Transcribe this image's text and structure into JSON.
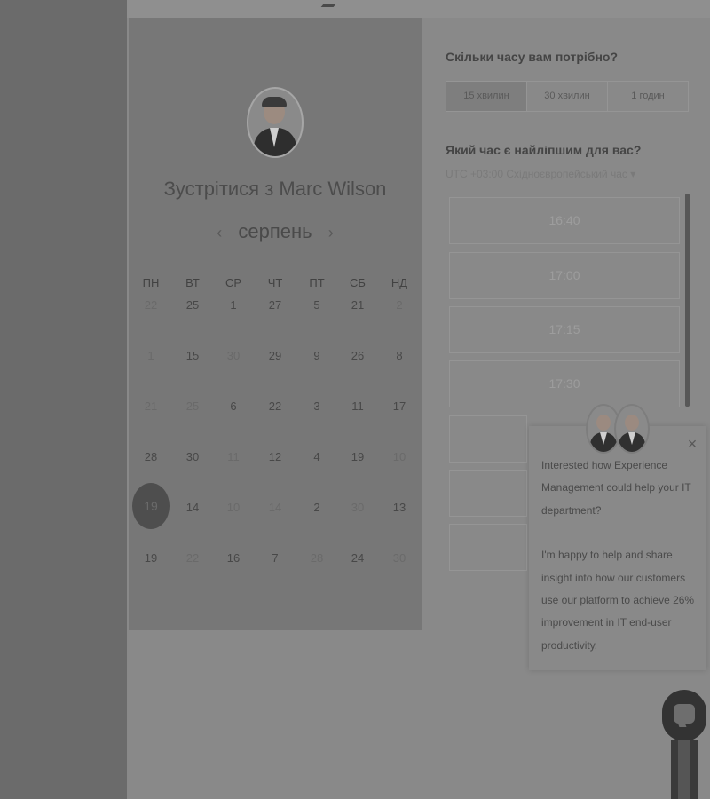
{
  "booking": {
    "meet_title": "Зустрітися з Marc Wilson",
    "month_label": "серпень",
    "prev_month_icon": "‹",
    "next_month_icon": "›",
    "weekdays": [
      "ПН",
      "ВТ",
      "СР",
      "ЧТ",
      "ПТ",
      "СБ",
      "НД"
    ],
    "calendar_rows": [
      [
        "22",
        "25",
        "1",
        "27",
        "5",
        "21",
        "2"
      ],
      [
        "1",
        "15",
        "30",
        "29",
        "9",
        "26",
        "8"
      ],
      [
        "21",
        "25",
        "6",
        "22",
        "3",
        "11",
        "17"
      ],
      [
        "28",
        "30",
        "11",
        "12",
        "4",
        "19",
        "10"
      ],
      [
        "19",
        "14",
        "10",
        "14",
        "2",
        "30",
        "13"
      ],
      [
        "19",
        "22",
        "16",
        "7",
        "28",
        "24",
        "30"
      ]
    ],
    "selected_day": "19"
  },
  "duration": {
    "title": "Скільки часу вам потрібно?",
    "options": [
      "15 хвилин",
      "30 хвилин",
      "1 годин"
    ],
    "active_index": 0
  },
  "times": {
    "title": "Який час є найліпшим для вас?",
    "timezone": "UTC +03:00 Східноєвропейський час ▾",
    "slots": [
      "16:40",
      "17:00",
      "17:15",
      "17:30"
    ]
  },
  "chat": {
    "close_icon": "×",
    "paragraph1": "Interested how Experience Management could help your IT department?",
    "paragraph2": "I'm happy to help and share insight into how our customers use our platform to achieve 26% improvement in IT end-user productivity."
  }
}
